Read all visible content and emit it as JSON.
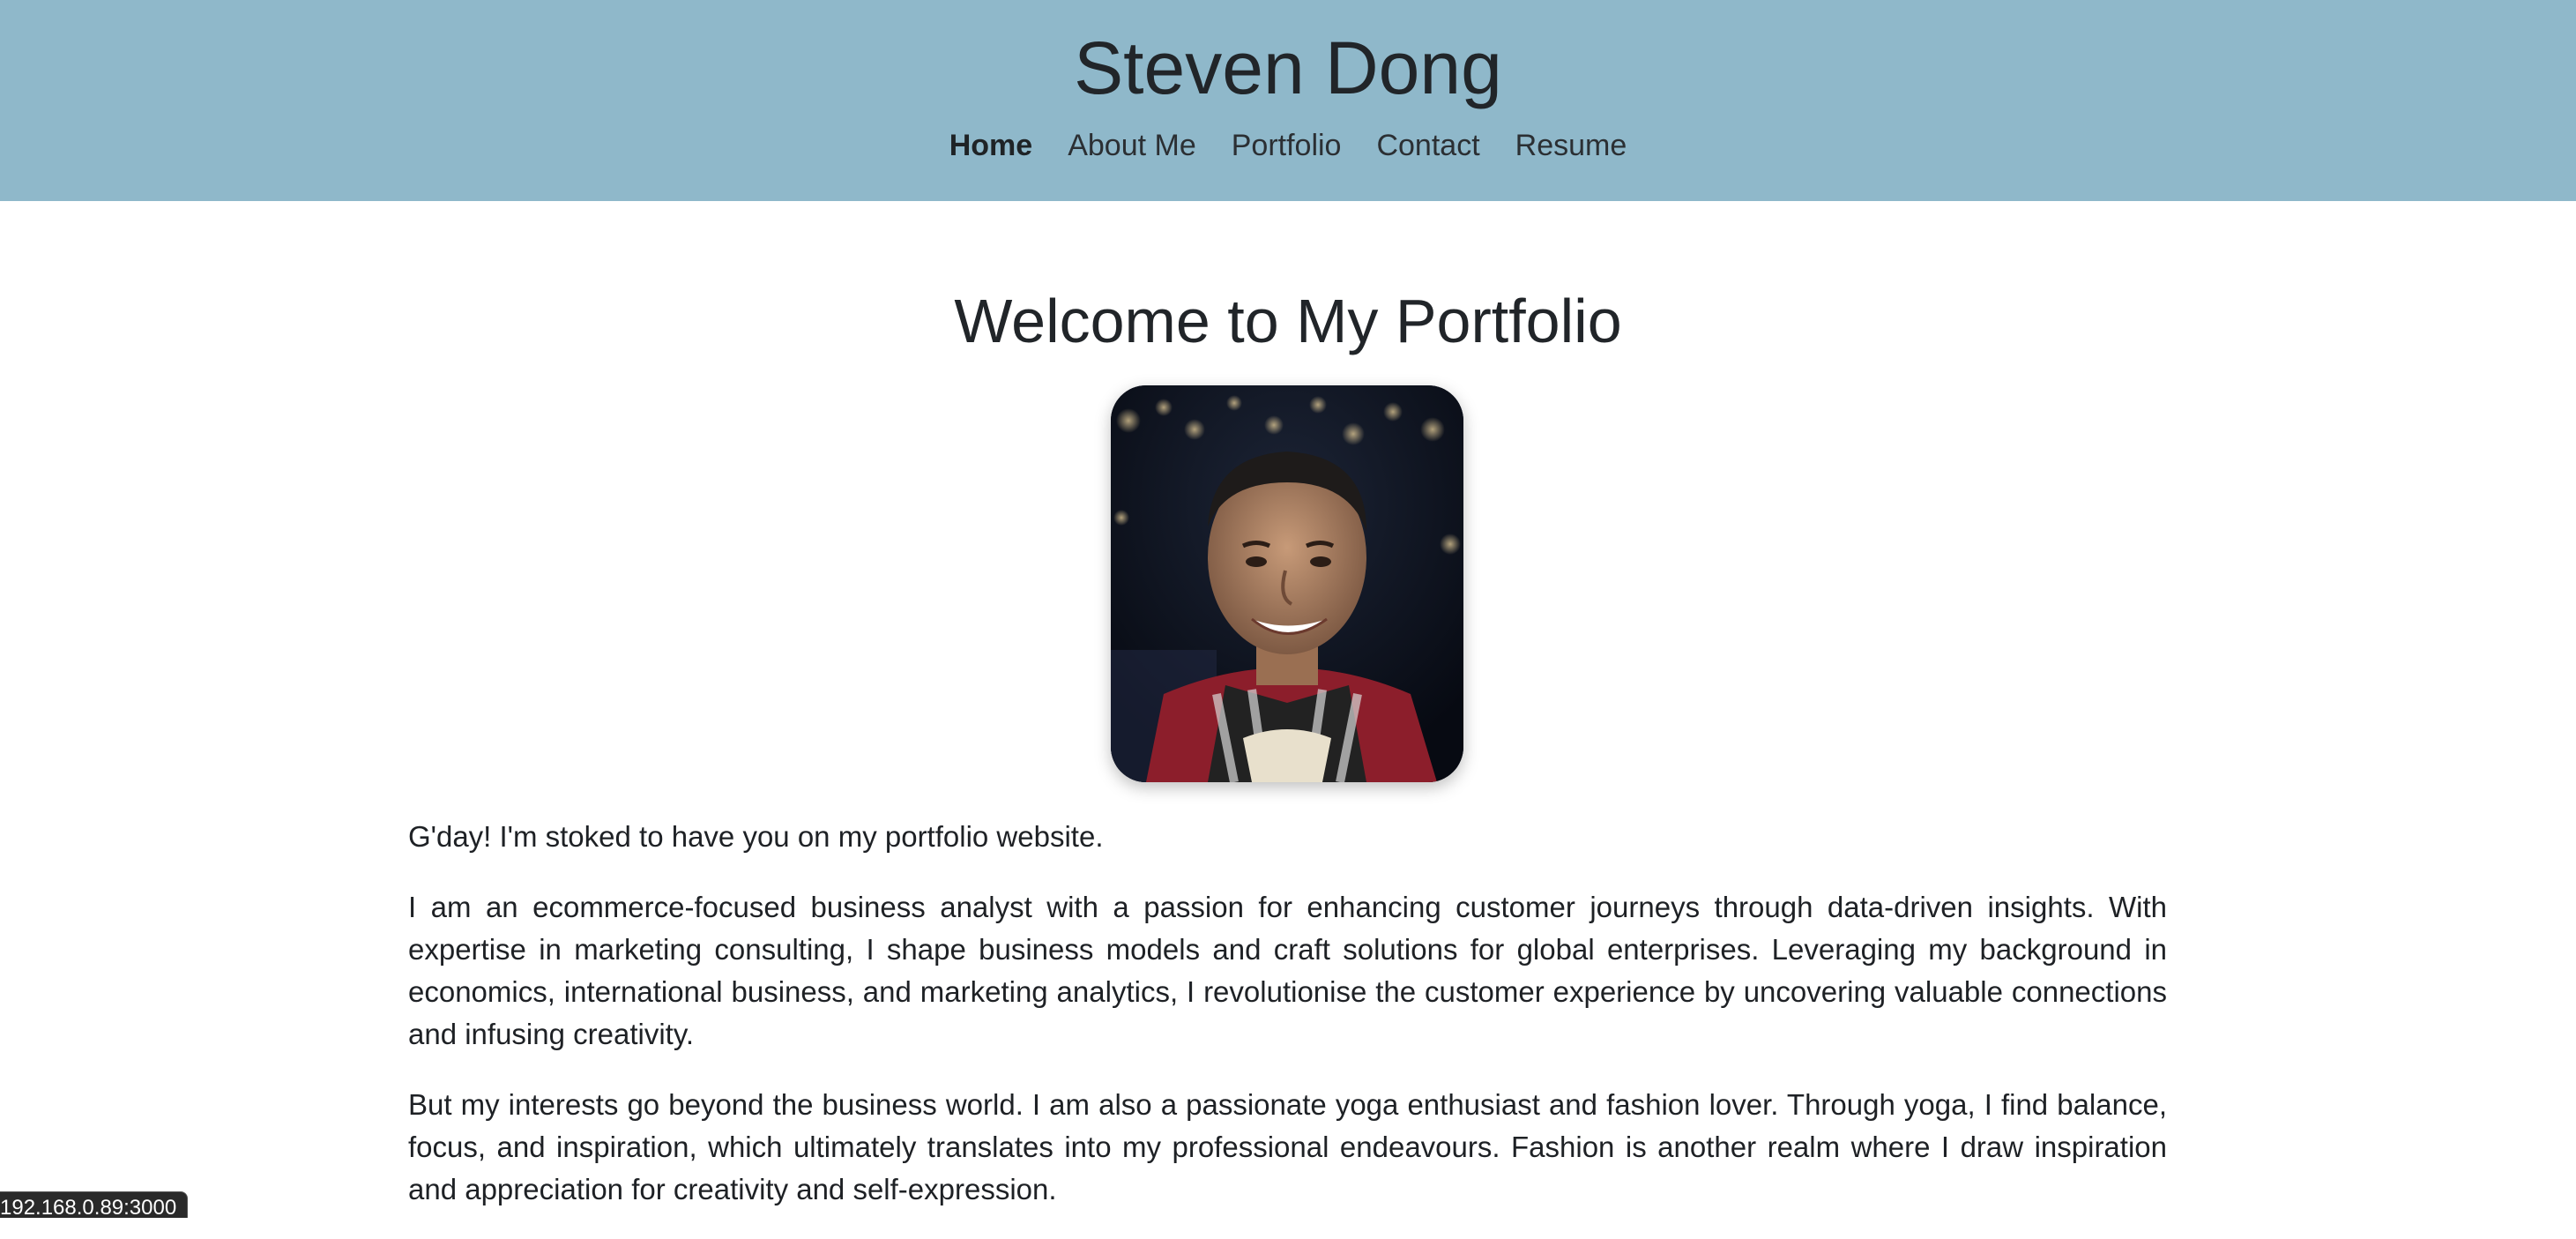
{
  "header": {
    "title": "Steven Dong",
    "nav": [
      {
        "label": "Home",
        "active": true
      },
      {
        "label": "About Me",
        "active": false
      },
      {
        "label": "Portfolio",
        "active": false
      },
      {
        "label": "Contact",
        "active": false
      },
      {
        "label": "Resume",
        "active": false
      }
    ],
    "bg_color": "#8fb8ca"
  },
  "main": {
    "heading": "Welcome to My Portfolio",
    "avatar_icon": "portrait-photo",
    "paragraphs": [
      "G'day! I'm stoked to have you on my portfolio website.",
      "I am an ecommerce-focused business analyst with a passion for enhancing customer journeys through data-driven insights. With expertise in marketing consulting, I shape business models and craft solutions for global enterprises. Leveraging my background in economics, international business, and marketing analytics, I revolutionise the customer experience by uncovering valuable connections and infusing creativity.",
      "But my interests go beyond the business world. I am also a passionate yoga enthusiast and fashion lover. Through yoga, I find balance, focus, and inspiration, which ultimately translates into my professional endeavours. Fashion is another realm where I draw inspiration and appreciation for creativity and self-expression."
    ]
  },
  "status_bar": {
    "url": "192.168.0.89:3000"
  }
}
